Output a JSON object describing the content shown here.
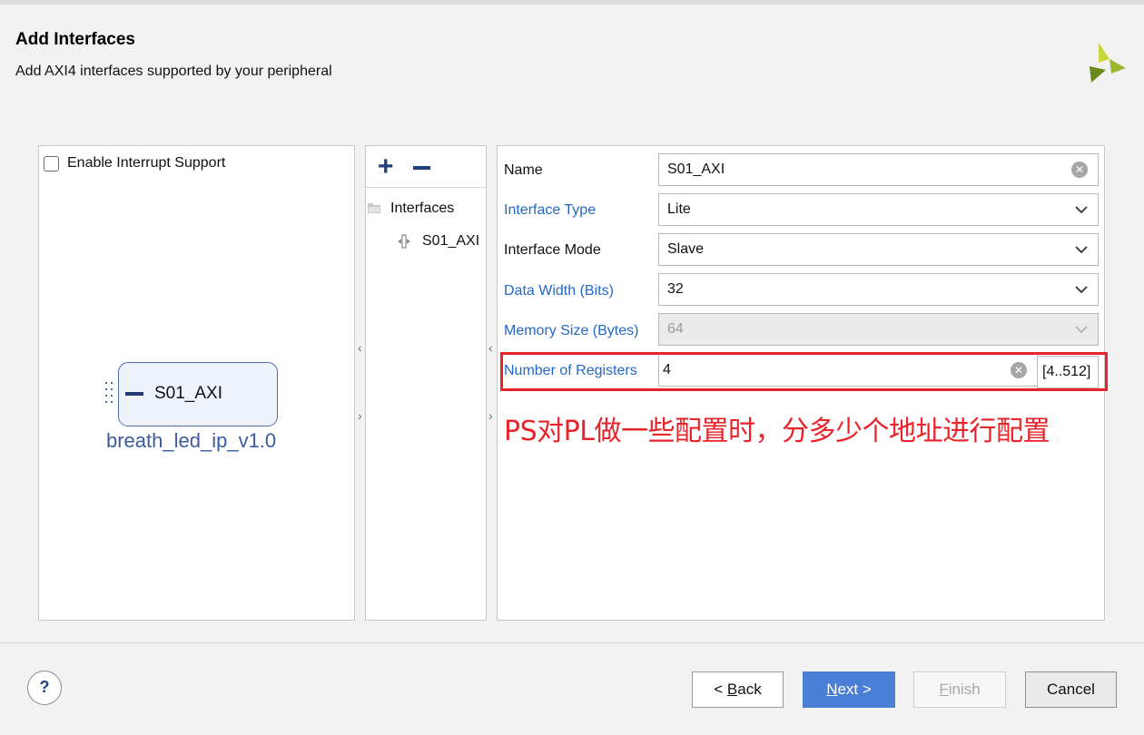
{
  "header": {
    "title": "Add Interfaces",
    "subtitle": "Add AXI4 interfaces supported by your peripheral"
  },
  "left_panel": {
    "checkbox_label": "Enable Interrupt Support",
    "checkbox_checked": false,
    "ip_port_label": "S01_AXI",
    "ip_name": "breath_led_ip_v1.0"
  },
  "middle_panel": {
    "add_symbol": "+",
    "tree_root": "Interfaces",
    "tree_items": [
      "S01_AXI"
    ]
  },
  "splitters": {
    "collapse_glyph": "‹",
    "expand_glyph": "›"
  },
  "properties": {
    "name": {
      "label": "Name",
      "value": "S01_AXI"
    },
    "interface_type": {
      "label": "Interface Type",
      "value": "Lite"
    },
    "interface_mode": {
      "label": "Interface Mode",
      "value": "Slave"
    },
    "data_width": {
      "label": "Data Width (Bits)",
      "value": "32"
    },
    "memory_size": {
      "label": "Memory Size (Bytes)",
      "value": "64"
    },
    "num_registers": {
      "label": "Number of Registers",
      "value": "4",
      "range": "[4..512]"
    }
  },
  "annotation": "PS对PL做一些配置时，分多少个地址进行配置",
  "footer": {
    "help_label": "?",
    "back": {
      "prefix": "< ",
      "mnemonic": "B",
      "rest": "ack"
    },
    "next": {
      "mnemonic": "N",
      "rest": "ext >"
    },
    "finish": {
      "mnemonic": "F",
      "rest": "inish"
    },
    "cancel": "Cancel"
  },
  "colors": {
    "link_label": "#2468c8",
    "annotation": "#e8232a",
    "primary_button": "#4a7fd6",
    "ip_name": "#3a5c9e"
  },
  "icons": [
    "vivado-logo-icon",
    "folder-icon",
    "port-icon",
    "clear-icon",
    "chevron-down-icon",
    "help-icon",
    "grip-icon"
  ]
}
